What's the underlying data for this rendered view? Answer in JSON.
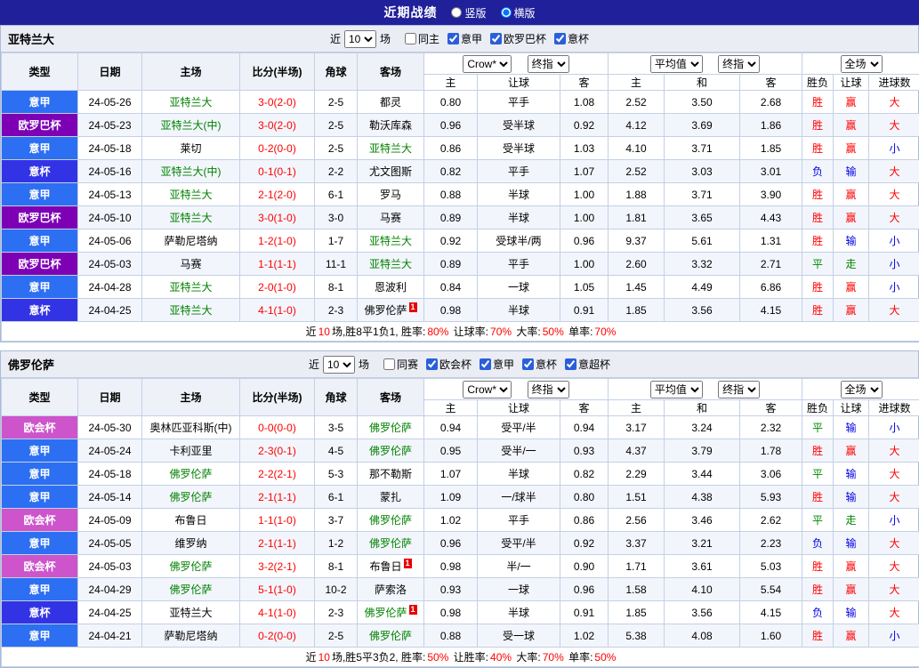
{
  "page": {
    "title": "近期战绩",
    "radio_vertical": "竖版",
    "radio_horizontal": "横版",
    "selected_layout": "横版"
  },
  "common": {
    "near_label": "近",
    "matches_label": "场",
    "rounds_value": "10",
    "col_headers": [
      "类型",
      "日期",
      "主场",
      "比分(半场)",
      "角球",
      "客场"
    ],
    "odds_headers": [
      "主",
      "让球",
      "客",
      "主",
      "和",
      "客",
      "胜负",
      "让球",
      "进球数"
    ],
    "selects": {
      "bookmaker": "Crow*",
      "final1": "终指",
      "average": "平均值",
      "final2": "终指",
      "fulltime": "全场"
    }
  },
  "league_colors": {
    "意甲": "#2d6ff2",
    "欧罗巴杯": "#7d00b5",
    "意杯": "#3333e6",
    "欧会杯": "#cd54cb"
  },
  "result_colors": {
    "胜": "#ff0000",
    "平": "#008800",
    "负": "#0000e6",
    "赢": "#ff0000",
    "走": "#008800",
    "输": "#0000e6",
    "大": "#ff0000",
    "小": "#0000e6"
  },
  "sections": [
    {
      "team": "亚特兰大",
      "filters": [
        {
          "label": "同主",
          "checked": false
        },
        {
          "label": "意甲",
          "checked": true
        },
        {
          "label": "欧罗巴杯",
          "checked": true
        },
        {
          "label": "意杯",
          "checked": true
        }
      ],
      "rows": [
        {
          "league": "意甲",
          "date": "24-05-26",
          "home": {
            "text": "亚特兰大",
            "green": true
          },
          "score": "3-0(2-0)",
          "corner": "2-5",
          "away": {
            "text": "都灵",
            "green": false
          },
          "odds": [
            "0.80",
            "平手",
            "1.08",
            "2.52",
            "3.50",
            "2.68"
          ],
          "results": [
            "胜",
            "赢",
            "大"
          ]
        },
        {
          "league": "欧罗巴杯",
          "date": "24-05-23",
          "home": {
            "text": "亚特兰大(中)",
            "green": true
          },
          "score": "3-0(2-0)",
          "corner": "2-5",
          "away": {
            "text": "勒沃库森",
            "green": false
          },
          "odds": [
            "0.96",
            "受半球",
            "0.92",
            "4.12",
            "3.69",
            "1.86"
          ],
          "results": [
            "胜",
            "赢",
            "大"
          ]
        },
        {
          "league": "意甲",
          "date": "24-05-18",
          "home": {
            "text": "莱切",
            "green": false
          },
          "score": "0-2(0-0)",
          "corner": "2-5",
          "away": {
            "text": "亚特兰大",
            "green": true
          },
          "odds": [
            "0.86",
            "受半球",
            "1.03",
            "4.10",
            "3.71",
            "1.85"
          ],
          "results": [
            "胜",
            "赢",
            "小"
          ]
        },
        {
          "league": "意杯",
          "date": "24-05-16",
          "home": {
            "text": "亚特兰大(中)",
            "green": true
          },
          "score": "0-1(0-1)",
          "corner": "2-2",
          "away": {
            "text": "尤文图斯",
            "green": false
          },
          "odds": [
            "0.82",
            "平手",
            "1.07",
            "2.52",
            "3.03",
            "3.01"
          ],
          "results": [
            "负",
            "输",
            "大"
          ]
        },
        {
          "league": "意甲",
          "date": "24-05-13",
          "home": {
            "text": "亚特兰大",
            "green": true
          },
          "score": "2-1(2-0)",
          "corner": "6-1",
          "away": {
            "text": "罗马",
            "green": false
          },
          "odds": [
            "0.88",
            "半球",
            "1.00",
            "1.88",
            "3.71",
            "3.90"
          ],
          "results": [
            "胜",
            "赢",
            "大"
          ]
        },
        {
          "league": "欧罗巴杯",
          "date": "24-05-10",
          "home": {
            "text": "亚特兰大",
            "green": true
          },
          "score": "3-0(1-0)",
          "corner": "3-0",
          "away": {
            "text": "马赛",
            "green": false
          },
          "odds": [
            "0.89",
            "半球",
            "1.00",
            "1.81",
            "3.65",
            "4.43"
          ],
          "results": [
            "胜",
            "赢",
            "大"
          ]
        },
        {
          "league": "意甲",
          "date": "24-05-06",
          "home": {
            "text": "萨勒尼塔纳",
            "green": false
          },
          "score": "1-2(1-0)",
          "corner": "1-7",
          "away": {
            "text": "亚特兰大",
            "green": true
          },
          "odds": [
            "0.92",
            "受球半/两",
            "0.96",
            "9.37",
            "5.61",
            "1.31"
          ],
          "results": [
            "胜",
            "输",
            "小"
          ]
        },
        {
          "league": "欧罗巴杯",
          "date": "24-05-03",
          "home": {
            "text": "马赛",
            "green": false
          },
          "score": "1-1(1-1)",
          "corner": "11-1",
          "away": {
            "text": "亚特兰大",
            "green": true
          },
          "odds": [
            "0.89",
            "平手",
            "1.00",
            "2.60",
            "3.32",
            "2.71"
          ],
          "results": [
            "平",
            "走",
            "小"
          ]
        },
        {
          "league": "意甲",
          "date": "24-04-28",
          "home": {
            "text": "亚特兰大",
            "green": true
          },
          "score": "2-0(1-0)",
          "corner": "8-1",
          "away": {
            "text": "恩波利",
            "green": false
          },
          "odds": [
            "0.84",
            "一球",
            "1.05",
            "1.45",
            "4.49",
            "6.86"
          ],
          "results": [
            "胜",
            "赢",
            "小"
          ]
        },
        {
          "league": "意杯",
          "date": "24-04-25",
          "home": {
            "text": "亚特兰大",
            "green": true
          },
          "score": "4-1(1-0)",
          "corner": "2-3",
          "away": {
            "text": "佛罗伦萨",
            "green": false,
            "badge": "1"
          },
          "odds": [
            "0.98",
            "半球",
            "0.91",
            "1.85",
            "3.56",
            "4.15"
          ],
          "results": [
            "胜",
            "赢",
            "大"
          ]
        }
      ],
      "footer_runs": [
        {
          "text": "近"
        },
        {
          "text": "10",
          "red": true
        },
        {
          "text": "场,胜8平1负1, 胜率:"
        },
        {
          "text": "80%",
          "red": true
        },
        {
          "text": " 让球率:"
        },
        {
          "text": "70%",
          "red": true
        },
        {
          "text": " 大率:"
        },
        {
          "text": "50%",
          "red": true
        },
        {
          "text": " 单率:"
        },
        {
          "text": "70%",
          "red": true
        }
      ]
    },
    {
      "team": "佛罗伦萨",
      "filters": [
        {
          "label": "同赛",
          "checked": false
        },
        {
          "label": "欧会杯",
          "checked": true
        },
        {
          "label": "意甲",
          "checked": true
        },
        {
          "label": "意杯",
          "checked": true
        },
        {
          "label": "意超杯",
          "checked": true
        }
      ],
      "rows": [
        {
          "league": "欧会杯",
          "date": "24-05-30",
          "home": {
            "text": "奥林匹亚科斯(中)",
            "green": false
          },
          "score": "0-0(0-0)",
          "corner": "3-5",
          "away": {
            "text": "佛罗伦萨",
            "green": true
          },
          "odds": [
            "0.94",
            "受平/半",
            "0.94",
            "3.17",
            "3.24",
            "2.32"
          ],
          "results": [
            "平",
            "输",
            "小"
          ]
        },
        {
          "league": "意甲",
          "date": "24-05-24",
          "home": {
            "text": "卡利亚里",
            "green": false
          },
          "score": "2-3(0-1)",
          "corner": "4-5",
          "away": {
            "text": "佛罗伦萨",
            "green": true
          },
          "odds": [
            "0.95",
            "受半/一",
            "0.93",
            "4.37",
            "3.79",
            "1.78"
          ],
          "results": [
            "胜",
            "赢",
            "大"
          ]
        },
        {
          "league": "意甲",
          "date": "24-05-18",
          "home": {
            "text": "佛罗伦萨",
            "green": true
          },
          "score": "2-2(2-1)",
          "corner": "5-3",
          "away": {
            "text": "那不勒斯",
            "green": false
          },
          "odds": [
            "1.07",
            "半球",
            "0.82",
            "2.29",
            "3.44",
            "3.06"
          ],
          "results": [
            "平",
            "输",
            "大"
          ]
        },
        {
          "league": "意甲",
          "date": "24-05-14",
          "home": {
            "text": "佛罗伦萨",
            "green": true
          },
          "score": "2-1(1-1)",
          "corner": "6-1",
          "away": {
            "text": "蒙扎",
            "green": false
          },
          "odds": [
            "1.09",
            "一/球半",
            "0.80",
            "1.51",
            "4.38",
            "5.93"
          ],
          "results": [
            "胜",
            "输",
            "大"
          ]
        },
        {
          "league": "欧会杯",
          "date": "24-05-09",
          "home": {
            "text": "布鲁日",
            "green": false
          },
          "score": "1-1(1-0)",
          "corner": "3-7",
          "away": {
            "text": "佛罗伦萨",
            "green": true
          },
          "odds": [
            "1.02",
            "平手",
            "0.86",
            "2.56",
            "3.46",
            "2.62"
          ],
          "results": [
            "平",
            "走",
            "小"
          ]
        },
        {
          "league": "意甲",
          "date": "24-05-05",
          "home": {
            "text": "维罗纳",
            "green": false
          },
          "score": "2-1(1-1)",
          "corner": "1-2",
          "away": {
            "text": "佛罗伦萨",
            "green": true
          },
          "odds": [
            "0.96",
            "受平/半",
            "0.92",
            "3.37",
            "3.21",
            "2.23"
          ],
          "results": [
            "负",
            "输",
            "大"
          ]
        },
        {
          "league": "欧会杯",
          "date": "24-05-03",
          "home": {
            "text": "佛罗伦萨",
            "green": true
          },
          "score": "3-2(2-1)",
          "corner": "8-1",
          "away": {
            "text": "布鲁日",
            "green": false,
            "badge": "1"
          },
          "odds": [
            "0.98",
            "半/一",
            "0.90",
            "1.71",
            "3.61",
            "5.03"
          ],
          "results": [
            "胜",
            "赢",
            "大"
          ]
        },
        {
          "league": "意甲",
          "date": "24-04-29",
          "home": {
            "text": "佛罗伦萨",
            "green": true
          },
          "score": "5-1(1-0)",
          "corner": "10-2",
          "away": {
            "text": "萨索洛",
            "green": false
          },
          "odds": [
            "0.93",
            "一球",
            "0.96",
            "1.58",
            "4.10",
            "5.54"
          ],
          "results": [
            "胜",
            "赢",
            "大"
          ]
        },
        {
          "league": "意杯",
          "date": "24-04-25",
          "home": {
            "text": "亚特兰大",
            "green": false
          },
          "score": "4-1(1-0)",
          "corner": "2-3",
          "away": {
            "text": "佛罗伦萨",
            "green": true,
            "badge": "1"
          },
          "odds": [
            "0.98",
            "半球",
            "0.91",
            "1.85",
            "3.56",
            "4.15"
          ],
          "results": [
            "负",
            "输",
            "大"
          ]
        },
        {
          "league": "意甲",
          "date": "24-04-21",
          "home": {
            "text": "萨勒尼塔纳",
            "green": false
          },
          "score": "0-2(0-0)",
          "corner": "2-5",
          "away": {
            "text": "佛罗伦萨",
            "green": true
          },
          "odds": [
            "0.88",
            "受一球",
            "1.02",
            "5.38",
            "4.08",
            "1.60"
          ],
          "results": [
            "胜",
            "赢",
            "小"
          ]
        }
      ],
      "footer_runs": [
        {
          "text": "近"
        },
        {
          "text": "10",
          "red": true
        },
        {
          "text": "场,胜5平3负2, 胜率:"
        },
        {
          "text": "50%",
          "red": true
        },
        {
          "text": " 让胜率:"
        },
        {
          "text": "40%",
          "red": true
        },
        {
          "text": " 大率:"
        },
        {
          "text": "70%",
          "red": true
        },
        {
          "text": " 单率:"
        },
        {
          "text": "50%",
          "red": true
        }
      ]
    }
  ]
}
